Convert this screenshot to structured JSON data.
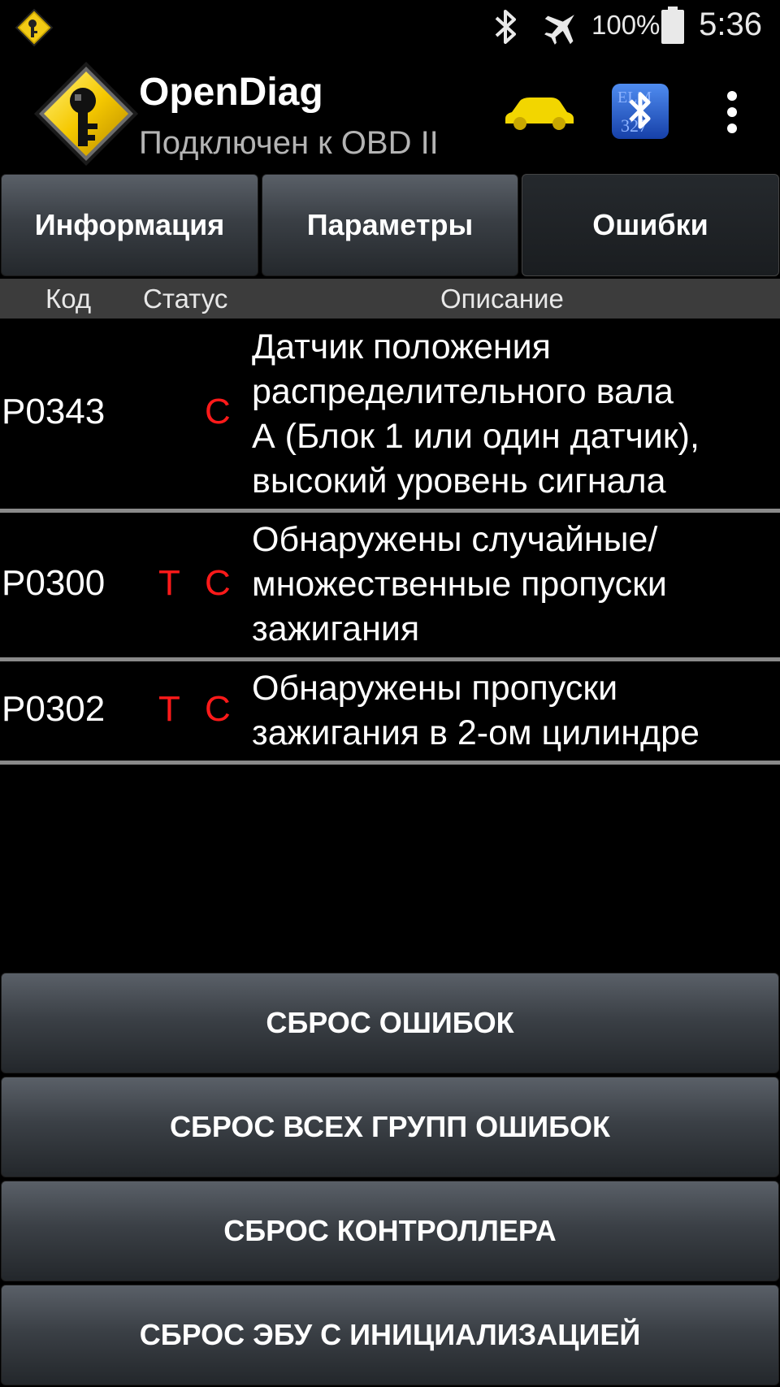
{
  "status_bar": {
    "battery": "100%",
    "time": "5:36"
  },
  "app": {
    "title": "OpenDiag",
    "subtitle": "Подключен к OBD II",
    "emulator_badge_text": "ELM 327"
  },
  "tabs": [
    {
      "label": "Информация"
    },
    {
      "label": "Параметры"
    },
    {
      "label": "Ошибки"
    }
  ],
  "table": {
    "headers": {
      "code": "Код",
      "status": "Статус",
      "description": "Описание"
    },
    "rows": [
      {
        "code": "P0343",
        "t": "",
        "c": "C",
        "lines": [
          "Датчик положения",
          "распределительного вала",
          "А (Блок 1 или один датчик),",
          "высокий уровень сигнала"
        ]
      },
      {
        "code": "P0300",
        "t": "T",
        "c": "C",
        "lines": [
          "Обнаружены случайные/",
          "множественные пропуски",
          "зажигания"
        ]
      },
      {
        "code": "P0302",
        "t": "T",
        "c": "C",
        "lines": [
          "Обнаружены пропуски",
          "зажигания в 2-ом цилиндре"
        ]
      }
    ]
  },
  "buttons": {
    "reset_errors": "СБРОС ОШИБОК",
    "reset_all_groups": "СБРОС ВСЕХ ГРУПП ОШИБОК",
    "reset_controller": "СБРОС КОНТРОЛЛЕРА",
    "reset_ecu_init": "СБРОС ЭБУ С ИНИЦИАЛИЗАЦИЕЙ"
  },
  "colors": {
    "status_fault": "#ff1a1a",
    "car": "#f2d600",
    "logo_yellow": "#f5c800",
    "bt_blue": "#1e5fd6"
  }
}
